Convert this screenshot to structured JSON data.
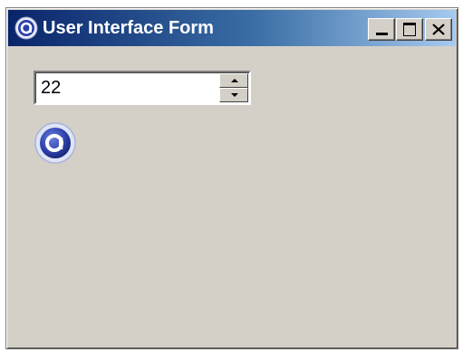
{
  "window": {
    "title": "User Interface Form",
    "title_icon": "app-logo-icon",
    "controls": {
      "minimize_icon": "minimize-icon",
      "maximize_icon": "maximize-icon",
      "close_icon": "close-icon"
    }
  },
  "form": {
    "spinner": {
      "value": "22"
    },
    "logo_icon": "app-logo-icon"
  },
  "colors": {
    "titlebar_start": "#0a246a",
    "titlebar_end": "#a6caf0",
    "window_background": "#d4d0c8",
    "logo_blue": "#2b3fa8"
  }
}
